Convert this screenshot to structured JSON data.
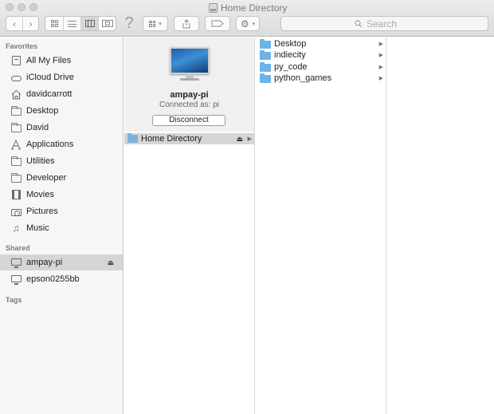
{
  "window": {
    "title": "Home Directory"
  },
  "toolbar": {
    "back": "‹",
    "forward": "›",
    "help": "?",
    "search_placeholder": "Search"
  },
  "sidebar": {
    "favorites_header": "Favorites",
    "favorites": [
      {
        "label": "All My Files",
        "icon": "all-files-icon"
      },
      {
        "label": "iCloud Drive",
        "icon": "cloud-icon"
      },
      {
        "label": "davidcarrott",
        "icon": "home-icon"
      },
      {
        "label": "Desktop",
        "icon": "desktop-icon"
      },
      {
        "label": "David",
        "icon": "folder-icon"
      },
      {
        "label": "Applications",
        "icon": "applications-icon"
      },
      {
        "label": "Utilities",
        "icon": "folder-icon"
      },
      {
        "label": "Developer",
        "icon": "folder-icon"
      },
      {
        "label": "Movies",
        "icon": "film-icon"
      },
      {
        "label": "Pictures",
        "icon": "camera-icon"
      },
      {
        "label": "Music",
        "icon": "music-note-icon"
      }
    ],
    "shared_header": "Shared",
    "shared": [
      {
        "label": "ampay-pi",
        "icon": "monitor-icon",
        "selected": true
      },
      {
        "label": "epson0255bb",
        "icon": "monitor-icon",
        "selected": false
      }
    ],
    "tags_header": "Tags"
  },
  "server": {
    "name": "ampay-pi",
    "connected_as": "Connected as: pi",
    "disconnect_label": "Disconnect",
    "share": "Home Directory"
  },
  "folders": [
    {
      "label": "Desktop"
    },
    {
      "label": "indiecity"
    },
    {
      "label": "py_code"
    },
    {
      "label": "python_games"
    }
  ],
  "colors": {
    "folder_blue": "#6db3e8",
    "selection_gray": "#d5d5d5"
  }
}
